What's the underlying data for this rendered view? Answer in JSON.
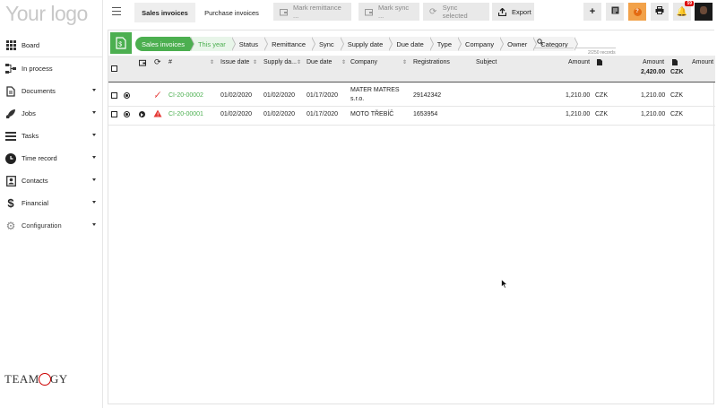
{
  "app": {
    "logo_text": "Your logo",
    "brand": "TEAMOGY"
  },
  "sidebar": {
    "items": [
      {
        "label": "Board",
        "icon": "grid-icon",
        "expandable": false
      },
      {
        "label": "In process",
        "icon": "flow-icon",
        "expandable": false
      },
      {
        "label": "Documents",
        "icon": "document-icon",
        "expandable": true
      },
      {
        "label": "Jobs",
        "icon": "rocket-icon",
        "expandable": true
      },
      {
        "label": "Tasks",
        "icon": "list-icon",
        "expandable": true
      },
      {
        "label": "Time record",
        "icon": "clock-icon",
        "expandable": true
      },
      {
        "label": "Contacts",
        "icon": "contact-card-icon",
        "expandable": true
      },
      {
        "label": "Financial",
        "icon": "dollar-icon",
        "expandable": true
      },
      {
        "label": "Configuration",
        "icon": "gear-icon",
        "expandable": true
      }
    ]
  },
  "topbar": {
    "tabs": [
      {
        "label": "Sales invoices",
        "selected": true
      },
      {
        "label": "Purchase invoices",
        "selected": false
      }
    ],
    "buttons": {
      "mark_remittance": "Mark remittance ...",
      "mark_sync": "Mark sync ...",
      "sync_selected": "Sync selected",
      "export": "Export"
    },
    "notification_count": "59"
  },
  "filters": {
    "crumbs": [
      "Sales invoices",
      "This year",
      "Status",
      "Remittance",
      "Sync",
      "Supply date",
      "Due date",
      "Type",
      "Company",
      "Owner",
      "Category"
    ],
    "search_placeholder": "",
    "records": "2/250 records"
  },
  "table": {
    "headers": {
      "number": "#",
      "issue_date": "Issue date",
      "supply_date": "Supply da...",
      "due_date": "Due date",
      "company": "Company",
      "registrations": "Registrations",
      "subject": "Subject",
      "amount": "Amount",
      "amount2": "Amount",
      "amount3": "Amount"
    },
    "totals": {
      "amount": "2,420.00",
      "currency": "CZK"
    },
    "rows": [
      {
        "status_icon": "double-check-icon",
        "number": "CI-20-00002",
        "issue_date": "01/02/2020",
        "supply_date": "01/02/2020",
        "due_date": "01/17/2020",
        "company": "MATER MATRES",
        "company_line2": "s.r.o.",
        "registrations": "29142342",
        "subject": "",
        "amount": "1,210.00",
        "currency": "CZK",
        "amount2": "1,210.00",
        "currency2": "CZK"
      },
      {
        "status_icon": "warning-icon",
        "number": "CI-20-00001",
        "issue_date": "01/02/2020",
        "supply_date": "01/02/2020",
        "due_date": "01/17/2020",
        "company": "MOTO TŘEBÍČ",
        "company_line2": "",
        "registrations": "1653954",
        "subject": "",
        "amount": "1,210.00",
        "currency": "CZK",
        "amount2": "1,210.00",
        "currency2": "CZK"
      }
    ]
  },
  "colors": {
    "accent": "#4caf50",
    "warning": "#e53935",
    "help": "#f2a24a"
  }
}
